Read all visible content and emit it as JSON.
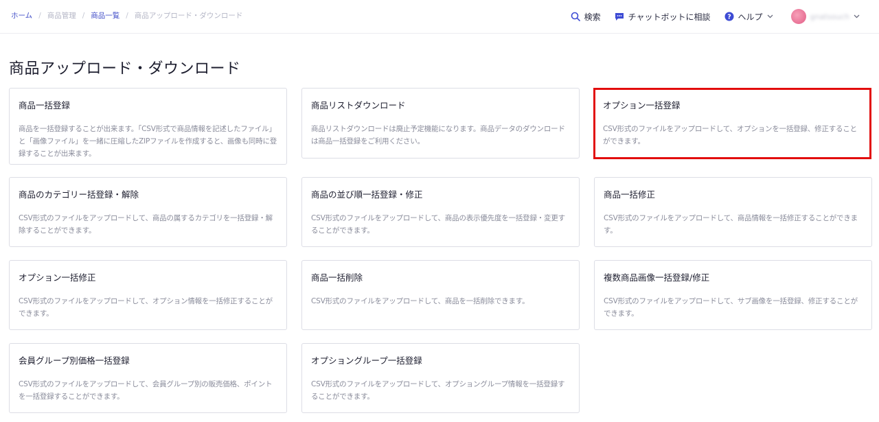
{
  "breadcrumb": {
    "home": "ホーム",
    "product_management": "商品管理",
    "product_list": "商品一覧",
    "current": "商品アップロード・ダウンロード",
    "separator": "/"
  },
  "header": {
    "search_label": "検索",
    "chatbot_label": "チャットボットに相談",
    "help_label": "ヘルプ",
    "username": "gnatsouch"
  },
  "page": {
    "title": "商品アップロード・ダウンロード"
  },
  "cards": [
    {
      "title": "商品一括登録",
      "desc": "商品を一括登録することが出来ます。「CSV形式で商品情報を記述したファイル」と「画像ファイル」を一緒に圧縮したZIPファイルを作成すると、画像も同時に登録することが出来ます。"
    },
    {
      "title": "商品リストダウンロード",
      "desc": "商品リストダウンロードは廃止予定機能になります。商品データのダウンロードは商品一括登録をご利用ください。"
    },
    {
      "title": "オプション一括登録",
      "desc": "CSV形式のファイルをアップロードして、オプションを一括登録、修正することができます。"
    },
    {
      "title": "商品のカテゴリー括登録・解除",
      "desc": "CSV形式のファイルをアップロードして、商品の属するカテゴリを一括登録・解除することができます。"
    },
    {
      "title": "商品の並び順一括登録・修正",
      "desc": "CSV形式のファイルをアップロードして、商品の表示優先度を一括登録・変更することができます。"
    },
    {
      "title": "商品一括修正",
      "desc": "CSV形式のファイルをアップロードして、商品情報を一括修正することができます。"
    },
    {
      "title": "オプション一括修正",
      "desc": "CSV形式のファイルをアップロードして、オプション情報を一括修正することができます。"
    },
    {
      "title": "商品一括削除",
      "desc": "CSV形式のファイルをアップロードして、商品を一括削除できます。"
    },
    {
      "title": "複数商品画像一括登録/修正",
      "desc": "CSV形式のファイルをアップロードして、サブ画像を一括登録、修正することができます。"
    },
    {
      "title": "会員グループ別価格一括登録",
      "desc": "CSV形式のファイルをアップロードして、会員グループ別の販売価格、ポイントを一括登録することができます。"
    },
    {
      "title": "オプショングループ一括登録",
      "desc": "CSV形式のファイルをアップロードして、オプショングループ情報を一括登録することができます。"
    }
  ],
  "colors": {
    "link": "#4450c8",
    "highlight_border": "#e20d0d",
    "icon": "#3d4bd4"
  },
  "icons": {
    "search": "search-icon",
    "chatbot": "chat-bubble-icon",
    "help": "help-circle-icon",
    "chevron": "chevron-down-icon"
  }
}
